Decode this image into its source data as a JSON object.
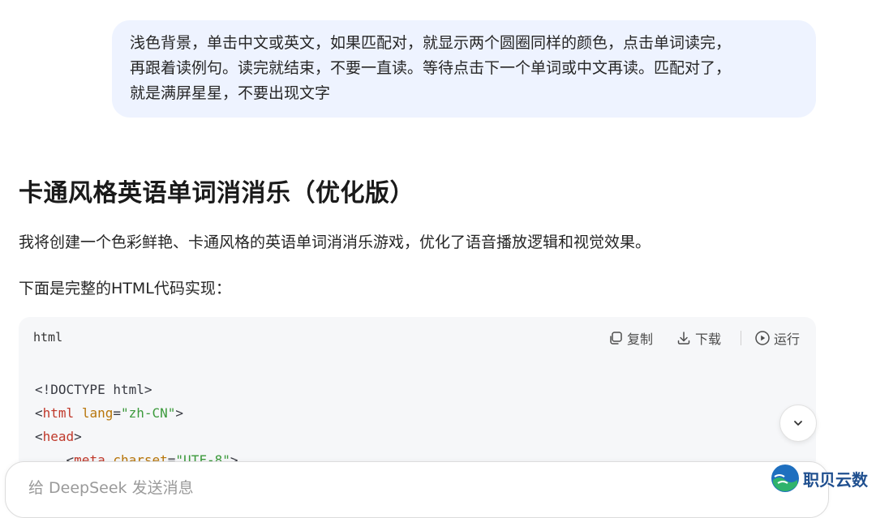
{
  "user_message": {
    "lines": [
      "浅色背景，单击中文或英文，如果匹配对，就显示两个圆圈同样的颜色，点击单词读完，",
      "再跟着读例句。读完就结束，不要一直读。等待点击下一个单词或中文再读。匹配对了，",
      "就是满屏星星，不要出现文字"
    ]
  },
  "response": {
    "title": "卡通风格英语单词消消乐（优化版）",
    "intro": "我将创建一个色彩鲜艳、卡通风格的英语单词消消乐游戏，优化了语音播放逻辑和视觉效果。",
    "code_intro": "下面是完整的HTML代码实现："
  },
  "code_block": {
    "language": "html",
    "copy_label": "复制",
    "download_label": "下载",
    "run_label": "运行",
    "lines": {
      "l1": "<!DOCTYPE html>",
      "l2_lt": "<",
      "l2_tag": "html",
      "l2_attr": "lang",
      "l2_eq": "=",
      "l2_val": "\"zh-CN\"",
      "l2_gt": ">",
      "l3_lt": "<",
      "l3_tag": "head",
      "l3_gt": ">",
      "l4_lt": "<",
      "l4_tag": "meta",
      "l4_attr": "charset",
      "l4_eq": "=",
      "l4_val": "\"UTF-8\"",
      "l4_gt": ">"
    }
  },
  "input": {
    "placeholder": "给 DeepSeek 发送消息"
  },
  "watermark": {
    "text": "职贝云数"
  },
  "colors": {
    "bubble_bg": "#eef3ff",
    "code_bg": "#f6f7f9",
    "tag": "#c0392b",
    "attr": "#b8760b",
    "string": "#3c9a3c"
  },
  "icons": [
    "copy-icon",
    "download-icon",
    "play-icon",
    "chevron-down-icon",
    "logo-icon"
  ]
}
